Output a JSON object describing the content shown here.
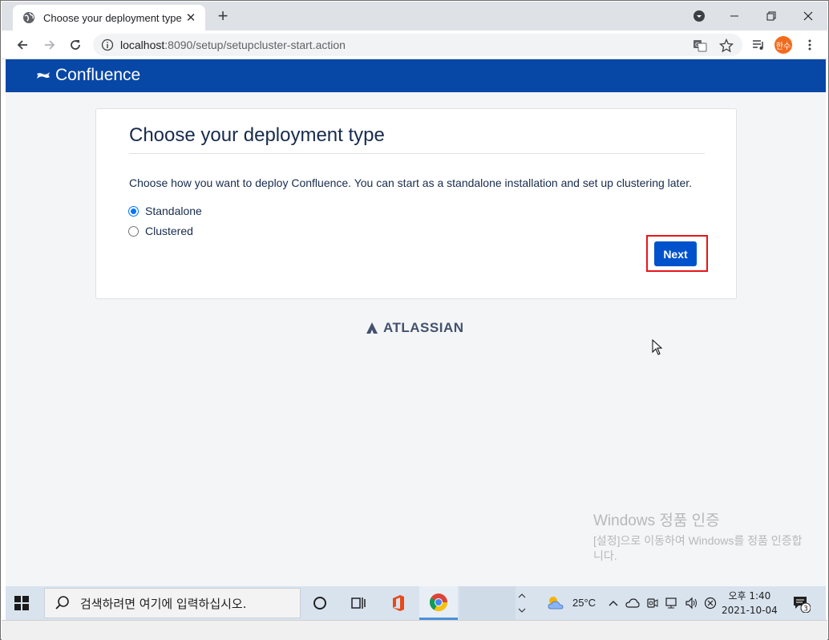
{
  "browser": {
    "tab_title": "Choose your deployment type",
    "tab_close": "✕",
    "new_tab": "+",
    "url_host": "localhost",
    "url_rest": ":8090/setup/setupcluster-start.action",
    "avatar_text": "한수"
  },
  "confluence": {
    "logo_text": "Confluence",
    "page_title": "Choose your deployment type",
    "description": "Choose how you want to deploy Confluence. You can start as a standalone installation and set up clustering later.",
    "options": [
      {
        "label": "Standalone",
        "checked": true
      },
      {
        "label": "Clustered",
        "checked": false
      }
    ],
    "next_button": "Next",
    "footer_logo": "ATLASSIAN",
    "colors": {
      "header": "#0747a6",
      "button": "#0052cc",
      "highlight": "#e8151b"
    }
  },
  "watermark": {
    "line1": "Windows 정품 인증",
    "line2": "[설정]으로 이동하여 Windows를 정품 인증합니다."
  },
  "taskbar": {
    "search_placeholder": "검색하려면 여기에 입력하십시오.",
    "temperature": "25°C",
    "time": "오후 1:40",
    "date": "2021-10-04",
    "notification_count": "3"
  }
}
